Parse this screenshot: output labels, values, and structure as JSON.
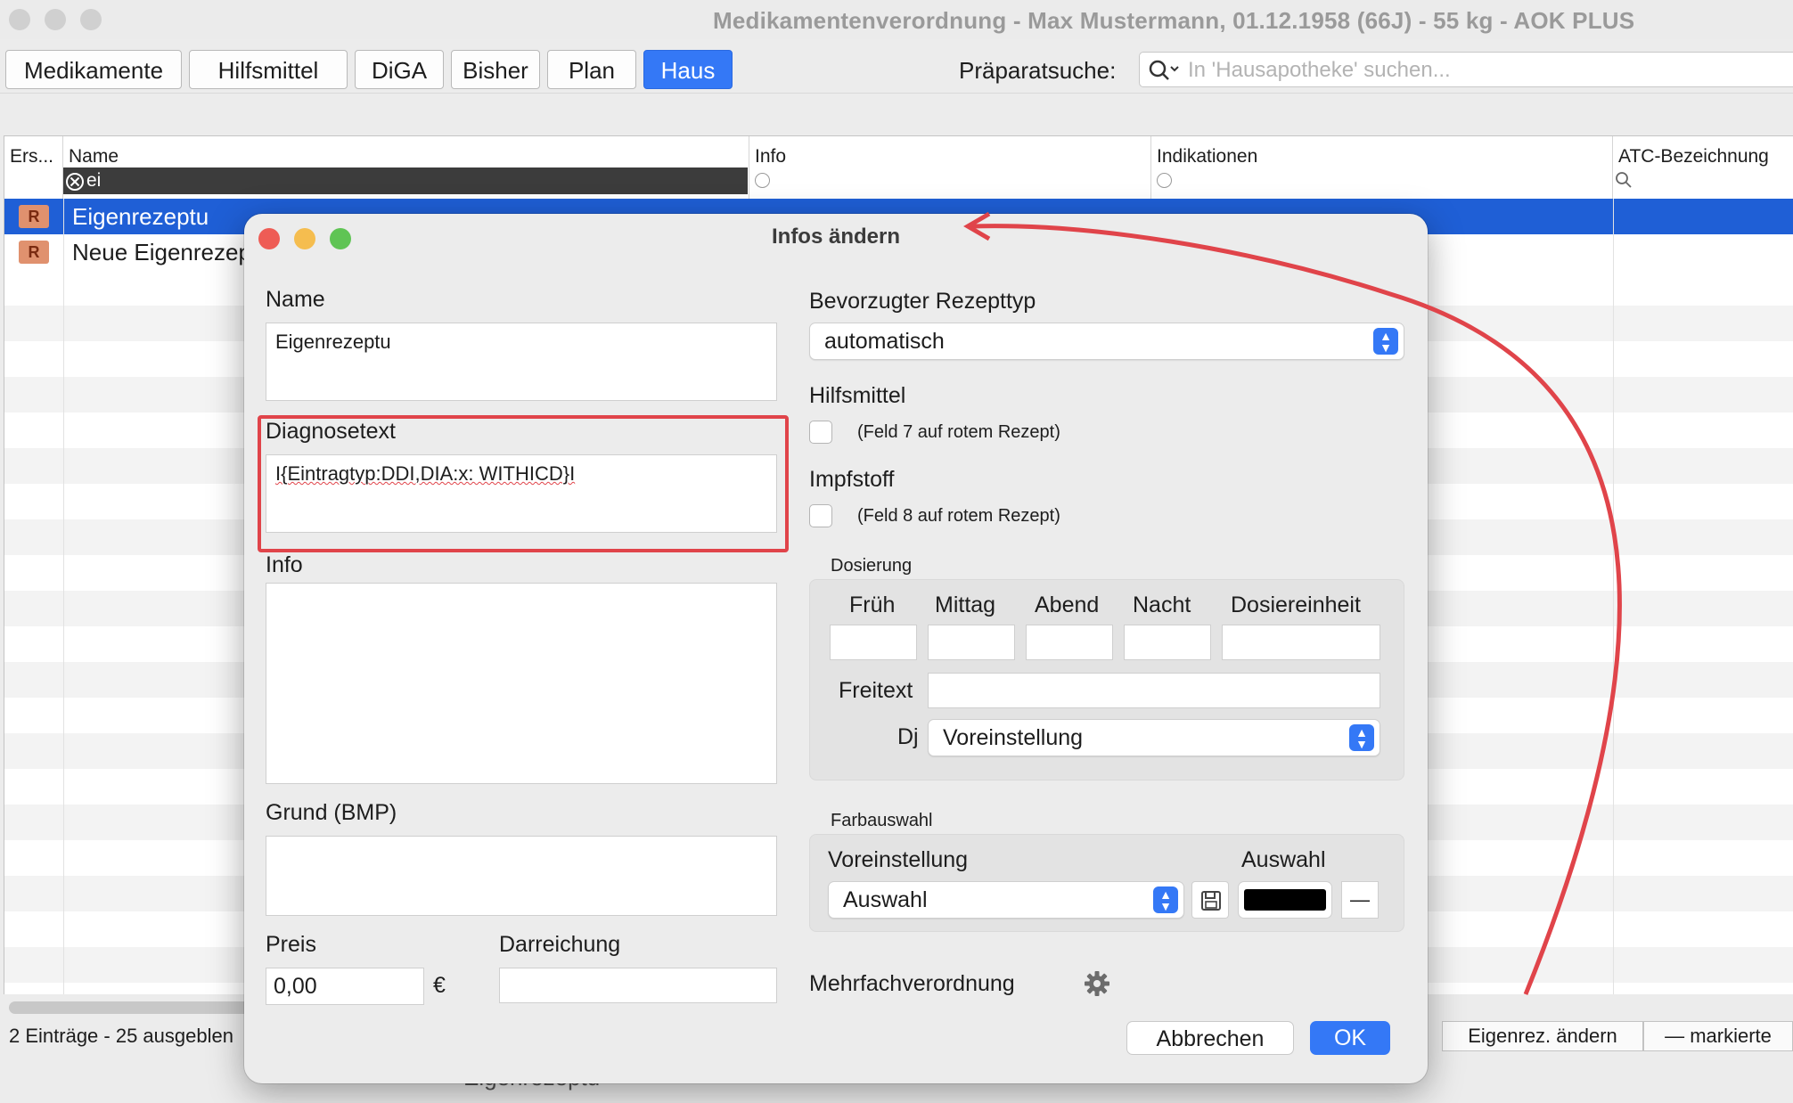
{
  "window": {
    "title": "Medikamentenverordnung - Max Mustermann, 01.12.1958 (66J) - 55 kg - AOK PLUS"
  },
  "tabs": [
    {
      "label": "Medikamente",
      "active": false
    },
    {
      "label": "Hilfsmittel",
      "active": false
    },
    {
      "label": "DiGA",
      "active": false
    },
    {
      "label": "Bisher",
      "active": false
    },
    {
      "label": "Plan",
      "active": false
    },
    {
      "label": "Haus",
      "active": true
    }
  ],
  "search": {
    "label": "Präparatsuche:",
    "placeholder": "In 'Hausapotheke' suchen..."
  },
  "table": {
    "columns": [
      "Ers...",
      "Name",
      "Info",
      "Indikationen",
      "ATC-Bezeichnung"
    ],
    "name_filter": "ei",
    "rows": [
      {
        "name": "Eigenrezeptu",
        "selected": true
      },
      {
        "name": "Neue Eigenrezep",
        "selected": false
      }
    ],
    "row_icon_text": "R"
  },
  "footer": {
    "status": "2 Einträge - 25 ausgeblen",
    "edit_button": "Eigenrez. ändern",
    "marked_button": "— markierte",
    "behind_text": "Eigenrezeptu"
  },
  "dialog": {
    "title": "Infos ändern",
    "name_label": "Name",
    "name_value": "Eigenrezeptu",
    "diagnose_label": "Diagnosetext",
    "diagnose_value": "I{Eintragtyp:DDI,DIA:x: WITHICD}I",
    "info_label": "Info",
    "grund_label": "Grund (BMP)",
    "preis_label": "Preis",
    "preis_value": "0,00",
    "currency": "€",
    "darreichung_label": "Darreichung",
    "rezepttyp_label": "Bevorzugter Rezepttyp",
    "rezepttyp_value": "automatisch",
    "hilfsmittel_label": "Hilfsmittel",
    "hilfsmittel_note": "(Feld 7 auf rotem Rezept)",
    "impfstoff_label": "Impfstoff",
    "impfstoff_note": "(Feld 8 auf rotem Rezept)",
    "dosierung_label": "Dosierung",
    "dosierung_cols": [
      "Früh",
      "Mittag",
      "Abend",
      "Nacht",
      "Dosiereinheit"
    ],
    "freitext_label": "Freitext",
    "dj_label": "Dj",
    "dj_value": "Voreinstellung",
    "farbauswahl_label": "Farbauswahl",
    "voreinstellung_label": "Voreinstellung",
    "auswahl_label": "Auswahl",
    "auswahl_value": "Auswahl",
    "selected_color": "#000000",
    "minus_label": "—",
    "mehrfach_label": "Mehrfachverordnung",
    "cancel_label": "Abbrechen",
    "ok_label": "OK"
  },
  "colors": {
    "accent": "#3478f6",
    "selection": "#1f5fd6",
    "annotation_red": "#e0444a"
  }
}
